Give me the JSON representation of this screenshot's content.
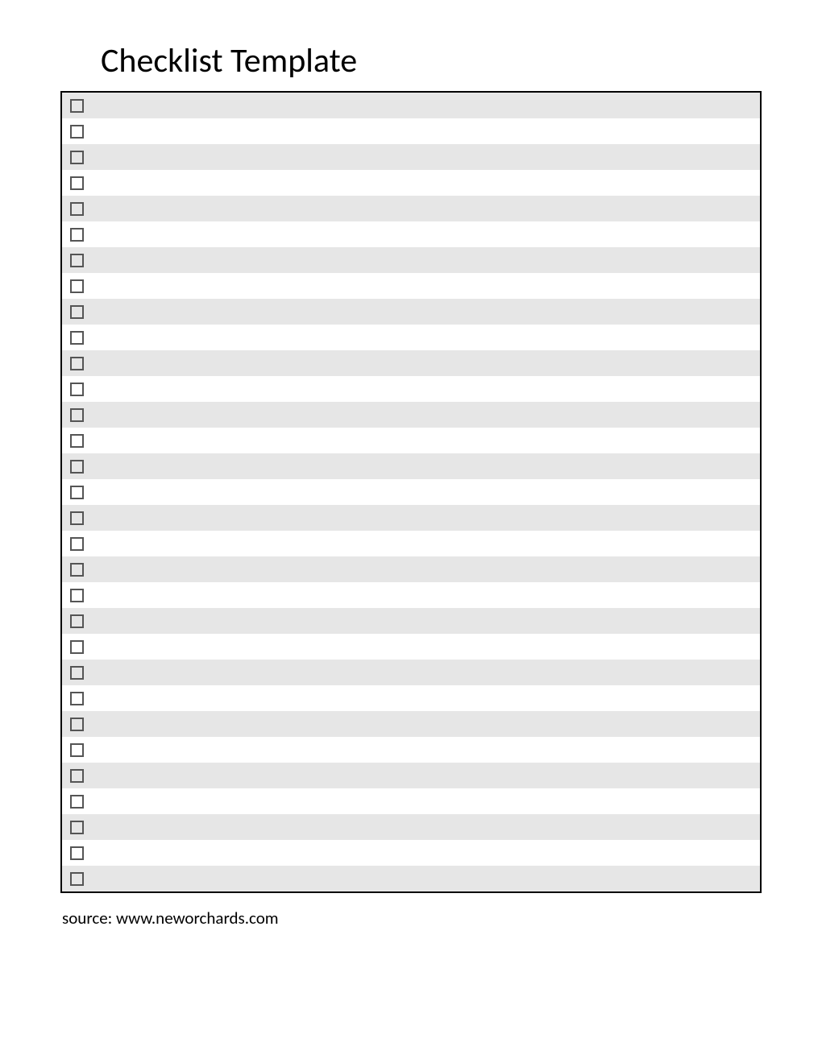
{
  "title": "Checklist Template",
  "rows": [
    {
      "text": "",
      "shaded": true
    },
    {
      "text": "",
      "shaded": false
    },
    {
      "text": "",
      "shaded": true
    },
    {
      "text": "",
      "shaded": false
    },
    {
      "text": "",
      "shaded": true
    },
    {
      "text": "",
      "shaded": false
    },
    {
      "text": "",
      "shaded": true
    },
    {
      "text": "",
      "shaded": false
    },
    {
      "text": "",
      "shaded": true
    },
    {
      "text": "",
      "shaded": false
    },
    {
      "text": "",
      "shaded": true
    },
    {
      "text": "",
      "shaded": false
    },
    {
      "text": "",
      "shaded": true
    },
    {
      "text": "",
      "shaded": false
    },
    {
      "text": "",
      "shaded": true
    },
    {
      "text": "",
      "shaded": false
    },
    {
      "text": "",
      "shaded": true
    },
    {
      "text": "",
      "shaded": false
    },
    {
      "text": "",
      "shaded": true
    },
    {
      "text": "",
      "shaded": false
    },
    {
      "text": "",
      "shaded": true
    },
    {
      "text": "",
      "shaded": false
    },
    {
      "text": "",
      "shaded": true
    },
    {
      "text": "",
      "shaded": false
    },
    {
      "text": "",
      "shaded": true
    },
    {
      "text": "",
      "shaded": false
    },
    {
      "text": "",
      "shaded": true
    },
    {
      "text": "",
      "shaded": false
    },
    {
      "text": "",
      "shaded": true
    },
    {
      "text": "",
      "shaded": false
    },
    {
      "text": "",
      "shaded": true
    }
  ],
  "source": "source: www.neworchards.com"
}
